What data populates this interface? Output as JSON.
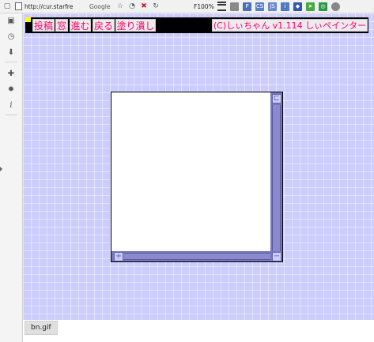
{
  "browser": {
    "url": "http://cur.starfre",
    "search_engine": "Google",
    "zoom": "F100%",
    "extensions": [
      {
        "name": "p-icon",
        "label": "P",
        "color": "#4a6fb5"
      },
      {
        "name": "css-icon",
        "label": "CS",
        "color": "#5a7fc9"
      },
      {
        "name": "js-icon",
        "label": "JS",
        "color": "#6688cc"
      },
      {
        "name": "info-icon",
        "label": "i",
        "color": "#4f79c0"
      },
      {
        "name": "puzzle-icon",
        "label": "",
        "color": "#3355aa"
      },
      {
        "name": "arrow-icon",
        "label": "",
        "color": "#44aa44"
      },
      {
        "name": "swirl-icon",
        "label": "",
        "color": "#2a9a4a"
      }
    ]
  },
  "sidebar": {
    "icons": [
      "bookmark-icon",
      "history-icon",
      "download-icon",
      "puzzle-icon",
      "gear-icon",
      "info-icon"
    ]
  },
  "menu": {
    "post": "投稿",
    "window": "窓",
    "forward": "進む",
    "back": "戻る",
    "fill": "塗り潰し",
    "copyright": "(C)しぃちゃん v1.114 しぃペインター"
  },
  "status": {
    "label": "bn.gif"
  },
  "colors": {
    "page_bg": "#ccccff",
    "menu_text": "#ff0066",
    "menu_bar": "#000000",
    "scrollbar": "#7777bb"
  }
}
